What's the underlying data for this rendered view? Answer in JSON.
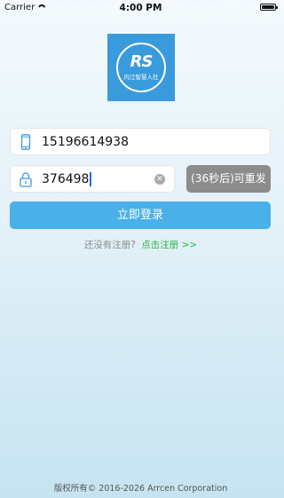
{
  "status_bar": {
    "carrier": "Carrier",
    "time": "4:00 PM",
    "wifi_icon": "wifi-icon",
    "battery_icon": "battery-icon"
  },
  "logo": {
    "mark": "RS",
    "text": "内江智慧人社",
    "color": "#3a9bdc"
  },
  "phone": {
    "icon": "phone-icon",
    "value": "15196614938"
  },
  "code": {
    "icon": "lock-icon",
    "value": "376498",
    "clear_icon": "clear-icon"
  },
  "resend_button": {
    "label": "(36秒后)可重发",
    "color": "#8c8c8c"
  },
  "login_button": {
    "label": "立即登录",
    "color": "#49b1e8"
  },
  "register": {
    "prompt": "还没有注册?",
    "link": "点击注册 >>",
    "link_color": "#29b43f"
  },
  "footer": {
    "copyright": "版权所有© 2016-2026 Arrcen Corporation"
  }
}
